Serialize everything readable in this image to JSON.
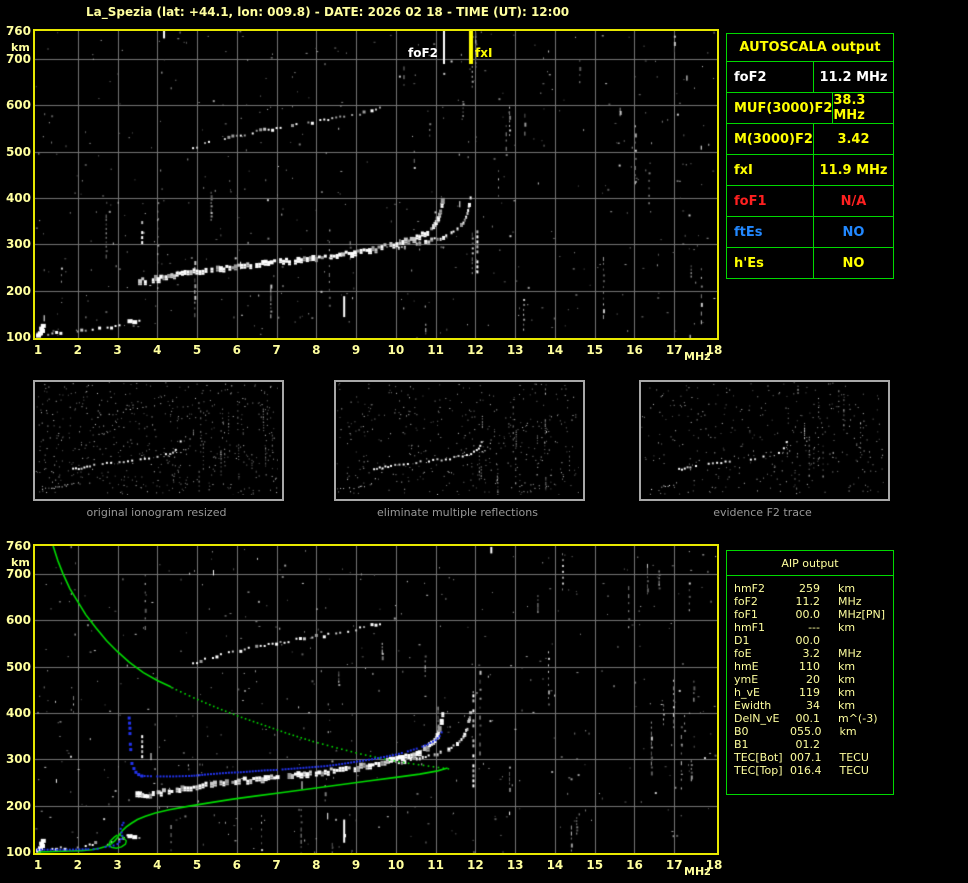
{
  "title": "La_Spezia (lat: +44.1, lon: 009.8) - DATE: 2026 02 18 - TIME (UT): 12:00",
  "colors": {
    "background": "#000000",
    "pale_yellow_text": "#ffff9e",
    "bright_yellow": "#ffff00",
    "table_border_green": "#00d800",
    "plot_border_yellow": "#e8e800",
    "grid_gray": "#757575",
    "trace_white": "#ffffff",
    "profile_green": "#00dd00",
    "trace_blue": "#2233ee",
    "fof1_red": "#ff2020",
    "ftes_blue": "#2288ff",
    "caption_gray": "#989898"
  },
  "axes": {
    "x_ticks": [
      "1",
      "2",
      "3",
      "4",
      "5",
      "6",
      "7",
      "8",
      "9",
      "10",
      "11",
      "12",
      "13",
      "14",
      "15",
      "16",
      "17",
      "18"
    ],
    "x_unit": "MHz",
    "y_ticks": [
      "760",
      "700",
      "600",
      "500",
      "400",
      "300",
      "200",
      "100"
    ],
    "y_tick_values": [
      760,
      700,
      600,
      500,
      400,
      300,
      200,
      100
    ],
    "y_unit": "km",
    "x_range": [
      1,
      18
    ],
    "y_range": [
      100,
      760
    ]
  },
  "markers": {
    "foF2": {
      "label": "foF2",
      "freq": 11.2
    },
    "fxI": {
      "label": "fxI",
      "freq": 11.9
    }
  },
  "autoscala_table": {
    "header": "AUTOSCALA output",
    "rows": [
      {
        "label": "foF2",
        "value": "11.2 MHz",
        "color": "white"
      },
      {
        "label": "MUF(3000)F2",
        "value": "38.3 MHz",
        "color": "yellow"
      },
      {
        "label": "M(3000)F2",
        "value": "3.42",
        "color": "yellow"
      },
      {
        "label": "fxI",
        "value": "11.9 MHz",
        "color": "yellow"
      },
      {
        "label": "foF1",
        "value": "N/A",
        "color": "red"
      },
      {
        "label": "ftEs",
        "value": "NO",
        "color": "blue"
      },
      {
        "label": "h'Es",
        "value": "NO",
        "color": "yellow"
      }
    ]
  },
  "aip_table": {
    "header": "AIP output",
    "rows": [
      {
        "label": "hmF2",
        "value": "259",
        "unit": "km",
        "extra": ""
      },
      {
        "label": "foF2",
        "value": "11.2",
        "unit": "MHz",
        "extra": ""
      },
      {
        "label": "foF1",
        "value": "00.0",
        "unit": "MHz",
        "extra": "[PN]"
      },
      {
        "label": "hmF1",
        "value": "---",
        "unit": "km",
        "extra": ""
      },
      {
        "label": "D1",
        "value": "00.0",
        "unit": "",
        "extra": ""
      },
      {
        "label": "foE",
        "value": "3.2",
        "unit": "MHz",
        "extra": ""
      },
      {
        "label": "hmE",
        "value": "110",
        "unit": "km",
        "extra": ""
      },
      {
        "label": "ymE",
        "value": "20",
        "unit": "km",
        "extra": ""
      },
      {
        "label": "h_vE",
        "value": "119",
        "unit": "km",
        "extra": ""
      },
      {
        "label": "Ewidth",
        "value": "34",
        "unit": "km",
        "extra": ""
      },
      {
        "label": "DelN_vE",
        "value": "00.1",
        "unit": "m^(-3)",
        "extra": ""
      },
      {
        "label": "B0",
        "value": "055.0",
        "unit": "km",
        "extra": ""
      },
      {
        "label": "B1",
        "value": "01.2",
        "unit": "",
        "extra": ""
      },
      {
        "label": "TEC[Bot]",
        "value": "007.1",
        "unit": "TECU",
        "extra": ""
      },
      {
        "label": "TEC[Top]",
        "value": "016.4",
        "unit": "TECU",
        "extra": ""
      }
    ]
  },
  "thumbnails": [
    {
      "caption": "original ionogram resized"
    },
    {
      "caption": "eliminate multiple reflections"
    },
    {
      "caption": "evidence F2 trace"
    }
  ],
  "traces": {
    "e_trace": [
      [
        1.0,
        104
      ],
      [
        1.15,
        106
      ],
      [
        2.0,
        110
      ],
      [
        2.1,
        113
      ],
      [
        2.2,
        112
      ],
      [
        2.3,
        116
      ],
      [
        2.45,
        118
      ],
      [
        2.55,
        117
      ],
      [
        2.65,
        120
      ],
      [
        2.75,
        121
      ],
      [
        2.85,
        122
      ],
      [
        2.95,
        124
      ],
      [
        3.05,
        126
      ],
      [
        3.15,
        129
      ],
      [
        3.25,
        133
      ],
      [
        3.35,
        136
      ],
      [
        3.45,
        131
      ],
      [
        3.55,
        133
      ]
    ],
    "f2_o": [
      [
        3.5,
        224
      ],
      [
        3.7,
        222
      ],
      [
        3.9,
        226
      ],
      [
        4.1,
        229
      ],
      [
        4.3,
        232
      ],
      [
        4.5,
        236
      ],
      [
        4.7,
        239
      ],
      [
        5.0,
        243
      ],
      [
        5.3,
        246
      ],
      [
        5.6,
        249
      ],
      [
        5.9,
        252
      ],
      [
        6.2,
        255
      ],
      [
        6.5,
        258
      ],
      [
        6.8,
        261
      ],
      [
        7.1,
        264
      ],
      [
        7.4,
        266
      ],
      [
        7.7,
        269
      ],
      [
        8.0,
        272
      ],
      [
        8.3,
        275
      ],
      [
        8.6,
        278
      ],
      [
        8.9,
        282
      ],
      [
        9.2,
        286
      ],
      [
        9.5,
        291
      ],
      [
        9.8,
        297
      ],
      [
        10.1,
        303
      ],
      [
        10.4,
        311
      ],
      [
        10.6,
        318
      ],
      [
        10.8,
        327
      ],
      [
        10.95,
        338
      ],
      [
        11.05,
        352
      ],
      [
        11.1,
        366
      ],
      [
        11.15,
        380
      ],
      [
        11.18,
        396
      ]
    ],
    "f2_x": [
      [
        10.0,
        292
      ],
      [
        10.3,
        297
      ],
      [
        10.6,
        303
      ],
      [
        10.9,
        309
      ],
      [
        11.2,
        316
      ],
      [
        11.4,
        324
      ],
      [
        11.55,
        334
      ],
      [
        11.7,
        349
      ],
      [
        11.8,
        368
      ],
      [
        11.85,
        386
      ],
      [
        11.88,
        402
      ]
    ],
    "hop2": [
      [
        4.9,
        505
      ],
      [
        5.1,
        512
      ],
      [
        5.3,
        518
      ],
      [
        5.5,
        524
      ],
      [
        5.8,
        530
      ],
      [
        6.1,
        536
      ],
      [
        6.4,
        541
      ],
      [
        6.7,
        546
      ],
      [
        7.0,
        551
      ],
      [
        7.3,
        555
      ],
      [
        7.6,
        559
      ],
      [
        7.9,
        563
      ],
      [
        8.2,
        567
      ],
      [
        8.5,
        572
      ],
      [
        8.8,
        577
      ],
      [
        9.1,
        582
      ],
      [
        9.4,
        587
      ],
      [
        9.6,
        592
      ]
    ],
    "corner_blob": [
      [
        1.0,
        103
      ],
      [
        1.05,
        108
      ],
      [
        1.1,
        113
      ],
      [
        1.08,
        118
      ],
      [
        1.12,
        124
      ],
      [
        3.3,
        134
      ],
      [
        3.42,
        132
      ]
    ],
    "streaks_top": [
      [
        8.7,
        143,
        188,
        1
      ],
      [
        3.62,
        300,
        350,
        0
      ],
      [
        4.17,
        744,
        760,
        1
      ],
      [
        12.05,
        240,
        330,
        0
      ]
    ],
    "streaks_bottom": [
      [
        8.7,
        120,
        170,
        1
      ],
      [
        11.95,
        240,
        440,
        0
      ],
      [
        3.62,
        300,
        352,
        0
      ],
      [
        12.4,
        744,
        758,
        1
      ]
    ]
  },
  "profile": {
    "green_solid_top": [
      [
        1.38,
        760
      ],
      [
        1.5,
        728
      ],
      [
        1.63,
        700
      ],
      [
        1.8,
        668
      ],
      [
        2.0,
        640
      ],
      [
        2.2,
        612
      ],
      [
        2.45,
        584
      ],
      [
        2.72,
        556
      ],
      [
        3.0,
        532
      ],
      [
        3.3,
        509
      ],
      [
        3.65,
        487
      ],
      [
        4.0,
        470
      ],
      [
        4.35,
        456
      ]
    ],
    "green_dotted": [
      [
        4.35,
        456
      ],
      [
        4.9,
        434
      ],
      [
        5.5,
        412
      ],
      [
        6.1,
        392
      ],
      [
        6.7,
        374
      ],
      [
        7.3,
        356
      ],
      [
        7.9,
        340
      ],
      [
        8.5,
        326
      ],
      [
        9.1,
        313
      ],
      [
        9.7,
        302
      ],
      [
        10.3,
        293
      ],
      [
        10.8,
        287
      ],
      [
        11.3,
        281
      ]
    ],
    "green_solid_bottom": [
      [
        11.3,
        281
      ],
      [
        11.05,
        275
      ],
      [
        10.6,
        268
      ],
      [
        10.0,
        261
      ],
      [
        9.3,
        253
      ],
      [
        8.6,
        245
      ],
      [
        7.9,
        237
      ],
      [
        7.2,
        229
      ],
      [
        6.5,
        221
      ],
      [
        5.9,
        214
      ],
      [
        5.3,
        206
      ],
      [
        4.8,
        199
      ],
      [
        4.3,
        191
      ],
      [
        3.95,
        184
      ],
      [
        3.7,
        177
      ],
      [
        3.5,
        170
      ],
      [
        3.35,
        162
      ],
      [
        3.22,
        154
      ],
      [
        3.12,
        146
      ],
      [
        3.05,
        138
      ],
      [
        3.0,
        131
      ],
      [
        2.93,
        124
      ],
      [
        2.83,
        117
      ],
      [
        2.7,
        112
      ],
      [
        2.55,
        108
      ],
      [
        2.35,
        105
      ],
      [
        2.1,
        103
      ],
      [
        1.8,
        102
      ],
      [
        1.4,
        101
      ],
      [
        1.0,
        100
      ]
    ],
    "green_loop": [
      [
        3.05,
        138
      ],
      [
        3.15,
        131
      ],
      [
        3.22,
        124
      ],
      [
        3.2,
        117
      ],
      [
        3.1,
        111
      ],
      [
        2.97,
        108
      ],
      [
        2.85,
        110
      ],
      [
        2.78,
        116
      ],
      [
        2.82,
        124
      ],
      [
        2.92,
        132
      ],
      [
        3.0,
        137
      ]
    ],
    "blue_e": [
      [
        1.0,
        105
      ],
      [
        1.4,
        105
      ],
      [
        1.8,
        105
      ],
      [
        2.2,
        106
      ],
      [
        2.4,
        106
      ],
      [
        2.5,
        107
      ],
      [
        2.6,
        109
      ],
      [
        2.7,
        111
      ],
      [
        2.8,
        112
      ],
      [
        2.9,
        114
      ],
      [
        3.0,
        117
      ],
      [
        3.05,
        122
      ],
      [
        3.1,
        128
      ],
      [
        3.12,
        135
      ],
      [
        3.1,
        142
      ],
      [
        3.08,
        150
      ],
      [
        3.12,
        158
      ],
      [
        3.15,
        163
      ]
    ],
    "blue_column": [
      [
        3.28,
        390
      ],
      [
        3.3,
        368
      ],
      [
        3.3,
        345
      ],
      [
        3.32,
        322
      ],
      [
        3.33,
        305
      ],
      [
        3.35,
        292
      ],
      [
        3.4,
        281
      ],
      [
        3.45,
        273
      ],
      [
        3.52,
        268
      ],
      [
        3.6,
        265
      ]
    ],
    "blue_f": [
      [
        3.6,
        264
      ],
      [
        4.0,
        263
      ],
      [
        4.4,
        263
      ],
      [
        4.8,
        264
      ],
      [
        5.0,
        265
      ],
      [
        5.2,
        267
      ],
      [
        5.5,
        269
      ],
      [
        5.8,
        271
      ],
      [
        6.1,
        272
      ],
      [
        6.4,
        274
      ],
      [
        6.7,
        276
      ],
      [
        7.0,
        277
      ],
      [
        7.3,
        279
      ],
      [
        7.6,
        281
      ],
      [
        7.9,
        283
      ],
      [
        8.2,
        285
      ],
      [
        8.5,
        288
      ],
      [
        8.8,
        292
      ],
      [
        9.1,
        296
      ],
      [
        9.4,
        300
      ],
      [
        9.7,
        305
      ],
      [
        10.0,
        310
      ],
      [
        10.3,
        317
      ],
      [
        10.6,
        325
      ],
      [
        10.8,
        332
      ],
      [
        11.0,
        341
      ],
      [
        11.1,
        350
      ],
      [
        11.15,
        358
      ]
    ]
  }
}
